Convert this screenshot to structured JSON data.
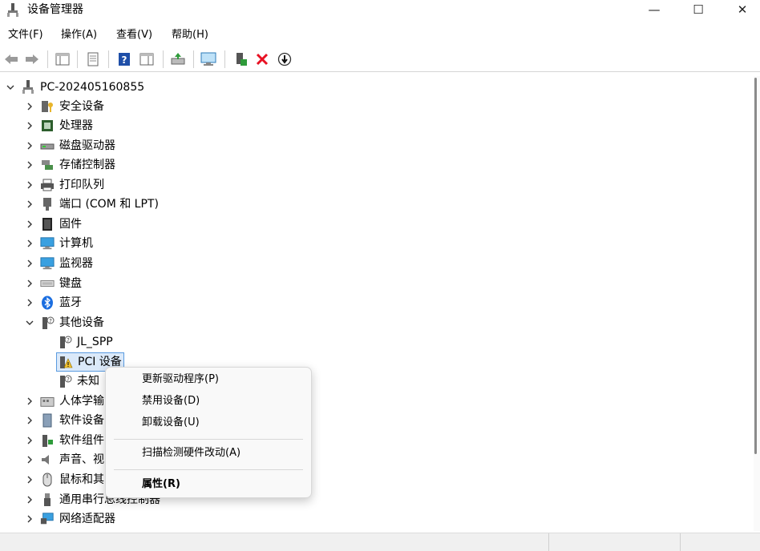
{
  "window": {
    "title": "设备管理器",
    "minimize_glyph": "—",
    "maximize_glyph": "☐",
    "close_glyph": "✕"
  },
  "menu": [
    "文件(F)",
    "操作(A)",
    "查看(V)",
    "帮助(H)"
  ],
  "toolbar": {
    "buttons": [
      "back-icon",
      "forward-icon",
      "show-hide-tree-icon",
      "properties-icon",
      "help-icon",
      "action-pane-icon",
      "update-driver-icon",
      "scan-hardware-icon",
      "add-driver-icon",
      "uninstall-icon",
      "disable-icon"
    ]
  },
  "tree": {
    "root": "PC-202405160855",
    "items": [
      {
        "label": "安全设备",
        "icon": "security-icon"
      },
      {
        "label": "处理器",
        "icon": "processor-icon"
      },
      {
        "label": "磁盘驱动器",
        "icon": "disk-icon"
      },
      {
        "label": "存储控制器",
        "icon": "storage-icon"
      },
      {
        "label": "打印队列",
        "icon": "printer-icon"
      },
      {
        "label": "端口 (COM 和 LPT)",
        "icon": "port-icon"
      },
      {
        "label": "固件",
        "icon": "firmware-icon"
      },
      {
        "label": "计算机",
        "icon": "computer-icon"
      },
      {
        "label": "监视器",
        "icon": "monitor-icon"
      },
      {
        "label": "键盘",
        "icon": "keyboard-icon"
      },
      {
        "label": "蓝牙",
        "icon": "bluetooth-icon"
      },
      {
        "label": "其他设备",
        "icon": "unknown-device-icon"
      },
      {
        "label": "JL_SPP",
        "icon": "unknown-device-icon"
      },
      {
        "label": "PCI 设备",
        "icon": "warning-device-icon"
      },
      {
        "label": "未知",
        "icon": "unknown-device-icon"
      },
      {
        "label": "人体学输",
        "icon": "hid-icon"
      },
      {
        "label": "软件设备",
        "icon": "software-device-icon"
      },
      {
        "label": "软件组件",
        "icon": "software-component-icon"
      },
      {
        "label": "声音、视",
        "icon": "sound-icon"
      },
      {
        "label": "鼠标和其",
        "icon": "mouse-icon"
      },
      {
        "label": "通用串行总线控制器",
        "icon": "usb-icon"
      },
      {
        "label": "网络适配器",
        "icon": "network-icon"
      }
    ]
  },
  "context_menu": {
    "items": [
      "更新驱动程序(P)",
      "禁用设备(D)",
      "卸载设备(U)",
      "扫描检测硬件改动(A)",
      "属性(R)"
    ]
  },
  "colors": {
    "selection_bg": "#dbe9f9",
    "selection_border": "#5a9be0",
    "uninstall_red": "#e81123",
    "help_blue": "#1f4fa8"
  }
}
